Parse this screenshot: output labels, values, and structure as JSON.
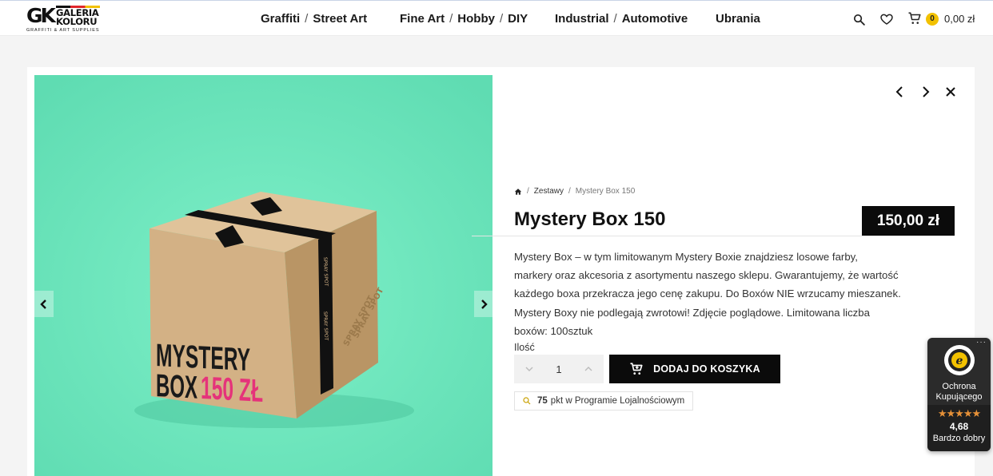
{
  "header": {
    "logo": {
      "initials": "GK",
      "name_line1": "GALERIA",
      "name_line2": "KOLORU",
      "tagline": "GRAFFITI & ART SUPPLIES"
    },
    "nav": [
      {
        "parts": [
          "Graffiti",
          "Street Art"
        ]
      },
      {
        "parts": [
          "Fine Art",
          "Hobby",
          "DIY"
        ]
      },
      {
        "parts": [
          "Industrial",
          "Automotive"
        ]
      },
      {
        "parts": [
          "Ubrania"
        ]
      }
    ],
    "nav_separator": "/",
    "cart_count": "0",
    "cart_total": "0,00 zł",
    "icons": [
      "search-icon",
      "heart-icon",
      "cart-icon"
    ]
  },
  "gallery": {
    "box_text_line1": "MYSTERY",
    "box_text_line2a": "BOX",
    "box_text_line2b": "150 ZŁ",
    "tape_text": "SPRAY SPOT",
    "colors": {
      "background": "#6de6bd",
      "box": "#d4b48a",
      "accent": "#e5337a"
    }
  },
  "product": {
    "breadcrumb": {
      "separator": "/",
      "category": "Zestawy",
      "current": "Mystery Box 150"
    },
    "title": "Mystery Box 150",
    "price": "150,00 zł",
    "description": [
      "Mystery Box – w tym limitowanym Mystery Boxie znajdziesz losowe farby,",
      "markery oraz akcesoria z asortymentu naszego sklepu. Gwarantujemy, że wartość",
      "każdego boxa przekracza jego cenę zakupu. Do Boxów NIE wrzucamy mieszanek.",
      "Mystery Boxy nie podlegają zwrotowi! Zdjęcie poglądowe. Limitowana liczba",
      "boxów: 100sztuk"
    ],
    "quantity_label": "Ilość",
    "quantity": "1",
    "add_to_cart": "DODAJ DO KOSZYKA",
    "loyalty_points": "75",
    "loyalty_text": "pkt w Programie Lojalnościowym"
  },
  "trusted_shops": {
    "line1": "Ochrona",
    "line2": "Kupującego",
    "stars": "★★★★★",
    "score": "4,68",
    "grade": "Bardzo dobry",
    "more": "···"
  }
}
